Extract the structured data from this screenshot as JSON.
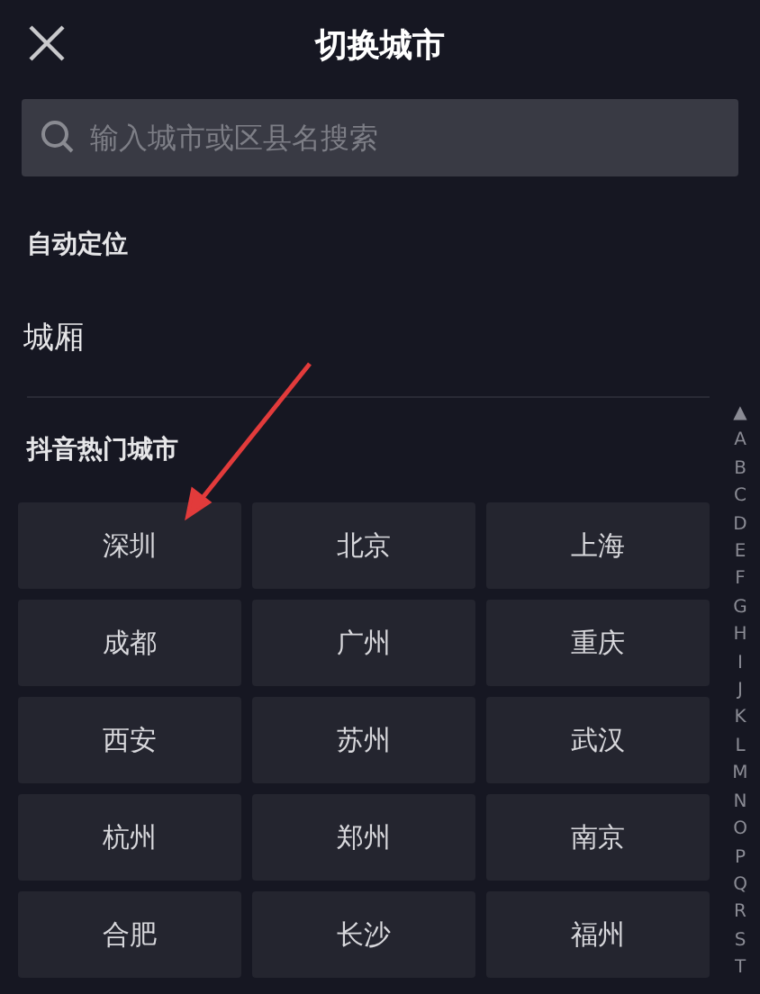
{
  "header": {
    "title": "切换城市"
  },
  "search": {
    "placeholder": "输入城市或区县名搜索"
  },
  "auto_location": {
    "heading": "自动定位",
    "city": "城厢"
  },
  "hot_cities": {
    "heading": "抖音热门城市",
    "cities": [
      "深圳",
      "北京",
      "上海",
      "成都",
      "广州",
      "重庆",
      "西安",
      "苏州",
      "武汉",
      "杭州",
      "郑州",
      "南京",
      "合肥",
      "长沙",
      "福州"
    ]
  },
  "index_bar": [
    "▲",
    "A",
    "B",
    "C",
    "D",
    "E",
    "F",
    "G",
    "H",
    "I",
    "J",
    "K",
    "L",
    "M",
    "N",
    "O",
    "P",
    "Q",
    "R",
    "S",
    "T"
  ]
}
